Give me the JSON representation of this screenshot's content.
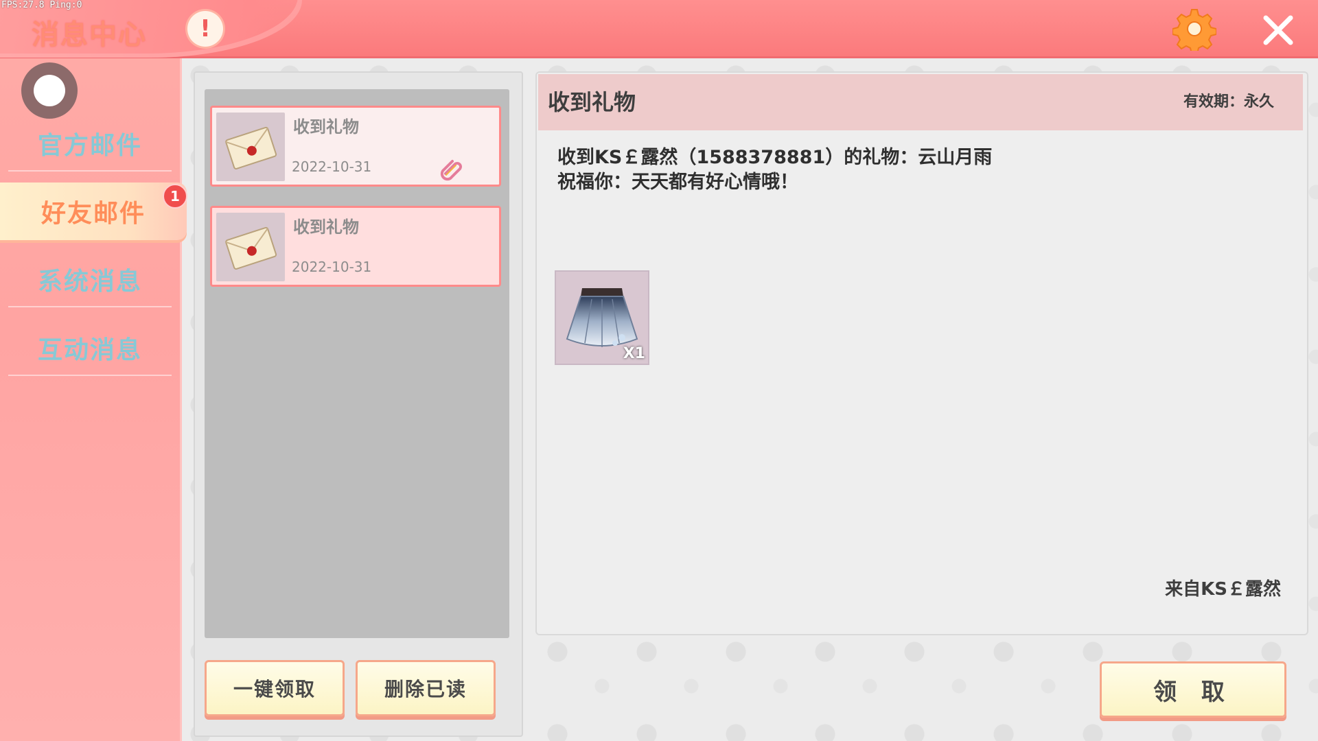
{
  "debug": {
    "fps_text": "FPS:27.8  Ping:0"
  },
  "header": {
    "title": "消息中心",
    "info_icon": "exclamation-icon",
    "settings_icon": "gear-icon",
    "close_icon": "close-icon"
  },
  "sidebar": {
    "items": [
      {
        "label": "官方邮件",
        "active": false
      },
      {
        "label": "好友邮件",
        "active": true,
        "badge": "1"
      },
      {
        "label": "系统消息",
        "active": false
      },
      {
        "label": "互动消息",
        "active": false
      }
    ]
  },
  "mail_list": {
    "items": [
      {
        "title": "收到礼物",
        "date": "2022-10-31",
        "has_attachment": true,
        "icon": "envelope-icon"
      },
      {
        "title": "收到礼物",
        "date": "2022-10-31",
        "has_attachment": false,
        "icon": "envelope-icon"
      }
    ],
    "claim_all_label": "一键领取",
    "delete_read_label": "删除已读"
  },
  "detail": {
    "title": "收到礼物",
    "validity": "有效期：永久",
    "body_line1": "收到KS￡露然（1588378881）的礼物：云山月雨",
    "body_line2": "祝福你：天天都有好心情哦！",
    "gift": {
      "icon": "skirt-icon",
      "quantity": "X1"
    },
    "sender": "来自KS￡露然",
    "claim_label": "领 取"
  },
  "colors": {
    "header_bg": "#fb7a7c",
    "sidebar_bg": "#ffa4a2",
    "active_tab_text": "#ff8d59",
    "inactive_tab_text": "#86c9d6",
    "button_bg": "#fcf4c5",
    "badge": "#f04d4d"
  }
}
